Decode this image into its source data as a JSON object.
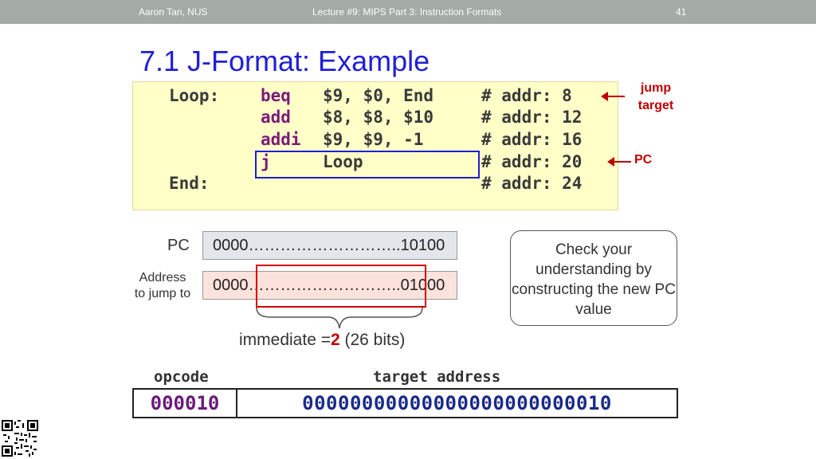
{
  "header": {
    "author": "Aaron Tan, NUS",
    "lecture": "Lecture #9: MIPS Part 3: Instruction Formats",
    "page_number": "41"
  },
  "title": "7.1 J-Format: Example",
  "code": {
    "lines": [
      {
        "label": "Loop:",
        "op": "beq",
        "args": "$9, $0, End",
        "comment": "# addr: 8"
      },
      {
        "label": "",
        "op": "add",
        "args": "$8, $8, $10",
        "comment": "# addr: 12"
      },
      {
        "label": "",
        "op": "addi",
        "args": "$9, $9, -1",
        "comment": "# addr: 16"
      },
      {
        "label": "",
        "op": "j",
        "args": "Loop",
        "comment": "# addr: 20"
      },
      {
        "label": "End:",
        "op": "",
        "args": "",
        "comment": "# addr: 24"
      }
    ]
  },
  "annotations": {
    "jump_target": "jump\ntarget",
    "pc": "PC"
  },
  "registers": {
    "pc_label": "PC",
    "pc_value": "0000………………………..10100",
    "addr_label": "Address\nto jump to",
    "addr_value": "0000………………………..01000"
  },
  "immediate": {
    "prefix": "immediate =",
    "value": "2",
    "suffix": " (26 bits)"
  },
  "check_box": "Check your understanding by constructing the new PC value",
  "format": {
    "opcode_label": "opcode",
    "target_label": "target address",
    "opcode_value": "000010",
    "target_value": "00000000000000000000000010"
  },
  "colors": {
    "title": "#1f1fd6",
    "header_bg": "#a3aba4",
    "highlight": "#c00000",
    "code_bg": "#ffffc8"
  }
}
